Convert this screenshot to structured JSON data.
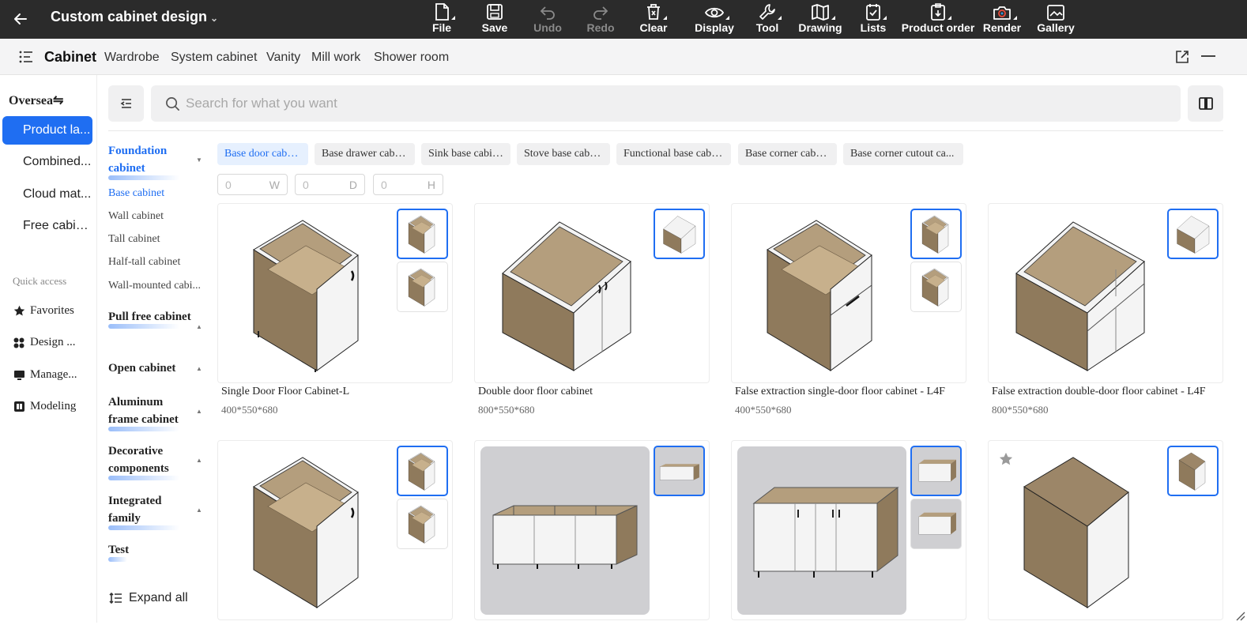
{
  "topbar": {
    "title": "Custom cabinet design",
    "tools": [
      {
        "label": "File",
        "icon": "file-icon",
        "enabled": true,
        "menu": true
      },
      {
        "label": "Save",
        "icon": "save-icon",
        "enabled": true,
        "menu": false
      },
      {
        "label": "Undo",
        "icon": "undo-icon",
        "enabled": false,
        "menu": false
      },
      {
        "label": "Redo",
        "icon": "redo-icon",
        "enabled": false,
        "menu": false
      },
      {
        "label": "Clear",
        "icon": "clear-icon",
        "enabled": true,
        "menu": true
      },
      {
        "label": "Display",
        "icon": "eye-icon",
        "enabled": true,
        "menu": true
      },
      {
        "label": "Tool",
        "icon": "wrench-icon",
        "enabled": true,
        "menu": true
      },
      {
        "label": "Drawing",
        "icon": "map-icon",
        "enabled": true,
        "menu": true
      },
      {
        "label": "Lists",
        "icon": "checklist-icon",
        "enabled": true,
        "menu": true
      },
      {
        "label": "Product order",
        "icon": "order-icon",
        "enabled": true,
        "menu": true
      },
      {
        "label": "Render",
        "icon": "camera-icon",
        "enabled": true,
        "menu": true
      },
      {
        "label": "Gallery",
        "icon": "gallery-icon",
        "enabled": true,
        "menu": false
      }
    ]
  },
  "tabs": {
    "items": [
      "Cabinet",
      "Wardrobe",
      "System cabinet",
      "Vanity",
      "Mill work",
      "Shower room"
    ],
    "active": "Cabinet"
  },
  "leftnav": {
    "region": "Oversea",
    "region_icon": "⇋",
    "items": [
      "Product la...",
      "Combined...",
      "Cloud mat...",
      "Free cabin..."
    ],
    "quick_access_label": "Quick access",
    "quick_items": [
      {
        "label": "Favorites",
        "icon": "star-icon"
      },
      {
        "label": "Design ...",
        "icon": "grid-icon"
      },
      {
        "label": "Manage...",
        "icon": "monitor-icon"
      },
      {
        "label": "Modeling",
        "icon": "modeling-icon"
      }
    ]
  },
  "search": {
    "placeholder": "Search for what you want",
    "value": ""
  },
  "categories": {
    "groups": [
      {
        "label": "Foundation cabinet",
        "expanded": true
      },
      {
        "label": "Pull free cabinet",
        "expanded": false
      },
      {
        "label": "Open cabinet",
        "expanded": false
      },
      {
        "label": "Aluminum frame cabinet",
        "expanded": false
      },
      {
        "label": "Decorative components",
        "expanded": false
      },
      {
        "label": "Integrated family",
        "expanded": false
      },
      {
        "label": "Test",
        "expanded": false
      }
    ],
    "subitems": [
      "Base cabinet",
      "Wall cabinet",
      "Tall cabinet",
      "Half-tall cabinet",
      "Wall-mounted cabi..."
    ],
    "active_sub": "Base cabinet",
    "expand_all": "Expand all"
  },
  "chips": [
    "Base door cabinet",
    "Base drawer cabinet",
    "Sink base cabinet",
    "Stove base cabinet",
    "Functional base cabinet",
    "Base corner cabinet",
    "Base corner cutout ca..."
  ],
  "dimensions": [
    {
      "placeholder": "0",
      "unit": "W"
    },
    {
      "placeholder": "0",
      "unit": "D"
    },
    {
      "placeholder": "0",
      "unit": "H"
    }
  ],
  "products": [
    {
      "name": "Single Door Floor Cabinet-L",
      "size": "400*550*680"
    },
    {
      "name": "Double door floor cabinet",
      "size": "800*550*680"
    },
    {
      "name": "False extraction single-door floor cabinet - L4F",
      "size": "400*550*680"
    },
    {
      "name": "False extraction double-door floor cabinet - L4F",
      "size": "800*550*680"
    }
  ],
  "colors": {
    "accent": "#1f6ef2",
    "topbar": "#2b2b2b",
    "wood": "#9c8668",
    "panel": "#f2f2f2"
  }
}
